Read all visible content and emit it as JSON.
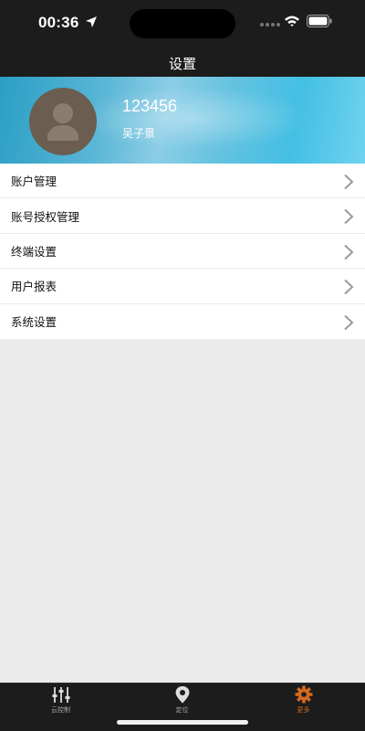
{
  "status_bar": {
    "time": "00:36"
  },
  "nav": {
    "title": "设置"
  },
  "profile": {
    "user_id": "123456",
    "user_name": "吴子景"
  },
  "menu": {
    "items": [
      {
        "label": "账户管理"
      },
      {
        "label": "账号授权管理"
      },
      {
        "label": "终端设置"
      },
      {
        "label": "用户报表"
      },
      {
        "label": "系统设置"
      }
    ]
  },
  "tab_bar": {
    "tabs": [
      {
        "label": "云控制",
        "icon": "sliders-icon"
      },
      {
        "label": "定位",
        "icon": "location-pin-icon"
      },
      {
        "label": "更多",
        "icon": "gear-icon",
        "active": true
      }
    ],
    "active_color": "#d2691e"
  }
}
